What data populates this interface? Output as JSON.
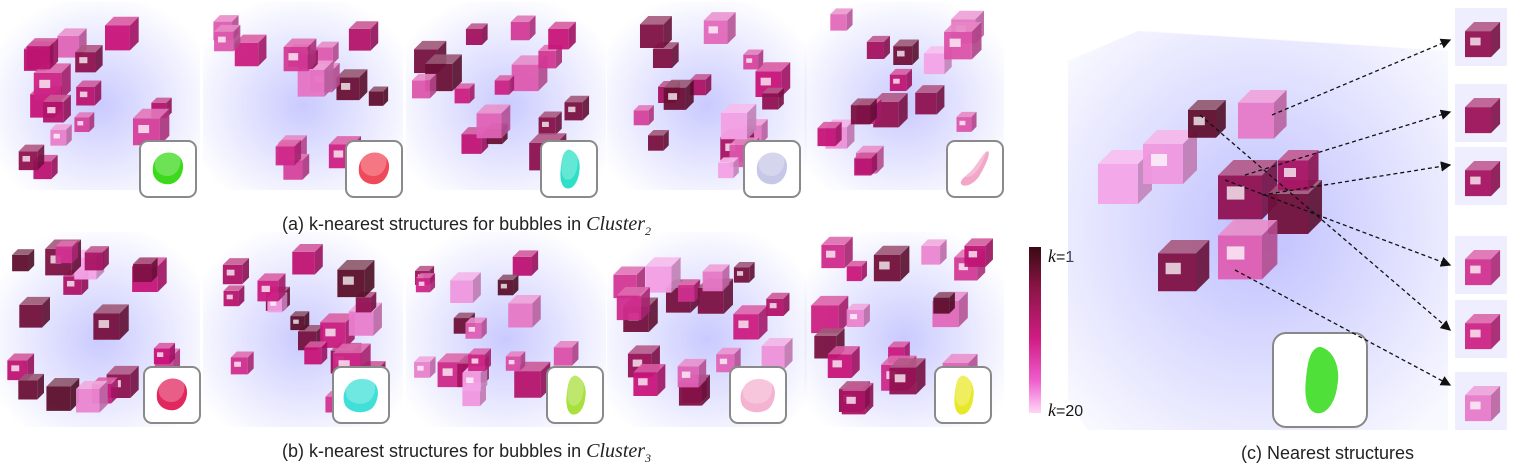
{
  "captions": {
    "a_prefix": "(a) k-nearest structures for bubbles in ",
    "a_cluster_name": "Cluster",
    "a_cluster_index": "2",
    "b_prefix": "(b) k-nearest structures for bubbles in ",
    "b_cluster_name": "Cluster",
    "b_cluster_index": "3",
    "c": "(c) Nearest structures"
  },
  "colorbar": {
    "top_label": "k=1",
    "bottom_label": "k=20",
    "top_k": "k",
    "top_val": "=1",
    "bottom_k": "k",
    "bottom_val": "=20"
  },
  "colors": {
    "volume_glow": "#b8b8ff",
    "k_near": "#5a0f2a",
    "k_mid": "#c8147a",
    "k_far": "#f4a6ea",
    "inset_border": "#8a8a8a"
  },
  "row_a_insets": [
    {
      "color": "#3cd91c",
      "shape": "blob"
    },
    {
      "color": "#f04a5a",
      "shape": "blob"
    },
    {
      "color": "#2fe0c8",
      "shape": "tall"
    },
    {
      "color": "#c7c7e8",
      "shape": "blob"
    },
    {
      "color": "#f3a7c8",
      "shape": "sliver"
    }
  ],
  "row_b_insets": [
    {
      "color": "#e0285e",
      "shape": "blob"
    },
    {
      "color": "#40e0d8",
      "shape": "wide"
    },
    {
      "color": "#a8e03c",
      "shape": "tall"
    },
    {
      "color": "#f4b3d0",
      "shape": "wide"
    },
    {
      "color": "#e8e82a",
      "shape": "tall"
    }
  ],
  "c_inset": {
    "color": "#4fe03a",
    "shape": "tall"
  }
}
